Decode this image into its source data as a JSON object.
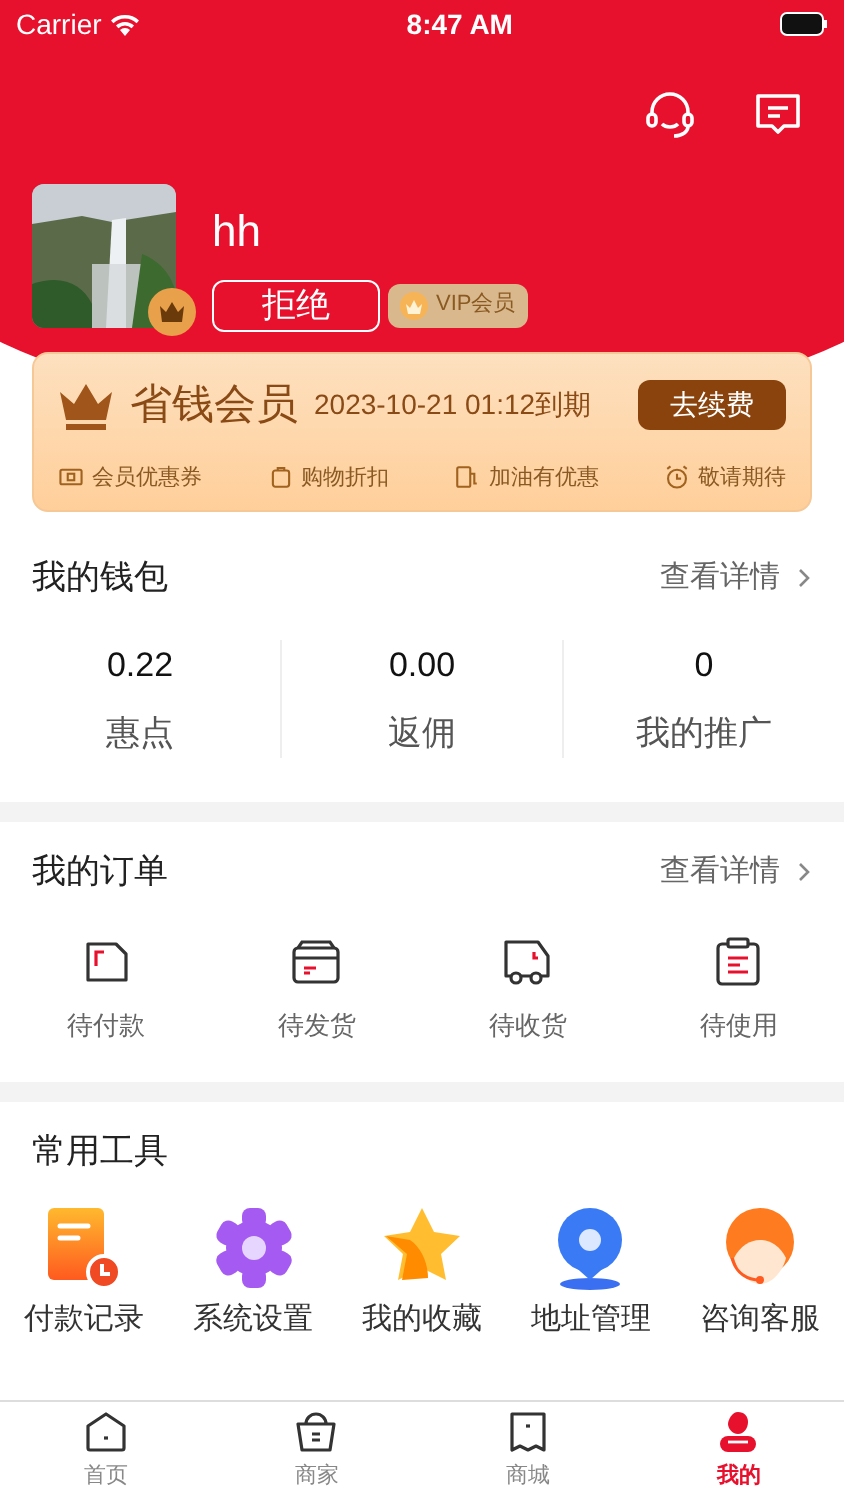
{
  "status_bar": {
    "carrier": "Carrier",
    "time": "8:47 AM"
  },
  "profile": {
    "name": "hh",
    "action_button": "拒绝",
    "vip_badge": "VIP会员"
  },
  "membership_card": {
    "title": "省钱会员",
    "expiry": "2023-10-21 01:12到期",
    "renew_button": "去续费",
    "perks": [
      {
        "kind": "ticket",
        "label": "会员优惠券"
      },
      {
        "kind": "bag",
        "label": "购物折扣"
      },
      {
        "kind": "fuel",
        "label": "加油有优惠"
      },
      {
        "kind": "clock",
        "label": "敬请期待"
      }
    ]
  },
  "wallet": {
    "title": "我的钱包",
    "details_link": "查看详情",
    "stats": [
      {
        "value": "0.22",
        "label": "惠点"
      },
      {
        "value": "0.00",
        "label": "返佣"
      },
      {
        "value": "0",
        "label": "我的推广"
      }
    ]
  },
  "orders": {
    "title": "我的订单",
    "details_link": "查看详情",
    "items": [
      {
        "kind": "card",
        "label": "待付款"
      },
      {
        "kind": "box",
        "label": "待发货"
      },
      {
        "kind": "truck",
        "label": "待收货"
      },
      {
        "kind": "clipboard",
        "label": "待使用"
      }
    ]
  },
  "tools": {
    "title": "常用工具",
    "items": [
      {
        "kind": "record",
        "label": "付款记录"
      },
      {
        "kind": "gear",
        "label": "系统设置"
      },
      {
        "kind": "star",
        "label": "我的收藏"
      },
      {
        "kind": "pin",
        "label": "地址管理"
      },
      {
        "kind": "agent",
        "label": "咨询客服"
      }
    ]
  },
  "tab_bar": [
    {
      "kind": "home",
      "label": "首页",
      "selected": false
    },
    {
      "kind": "basket",
      "label": "商家",
      "selected": false
    },
    {
      "kind": "shop",
      "label": "商城",
      "selected": false
    },
    {
      "kind": "person",
      "label": "我的",
      "selected": true
    }
  ]
}
